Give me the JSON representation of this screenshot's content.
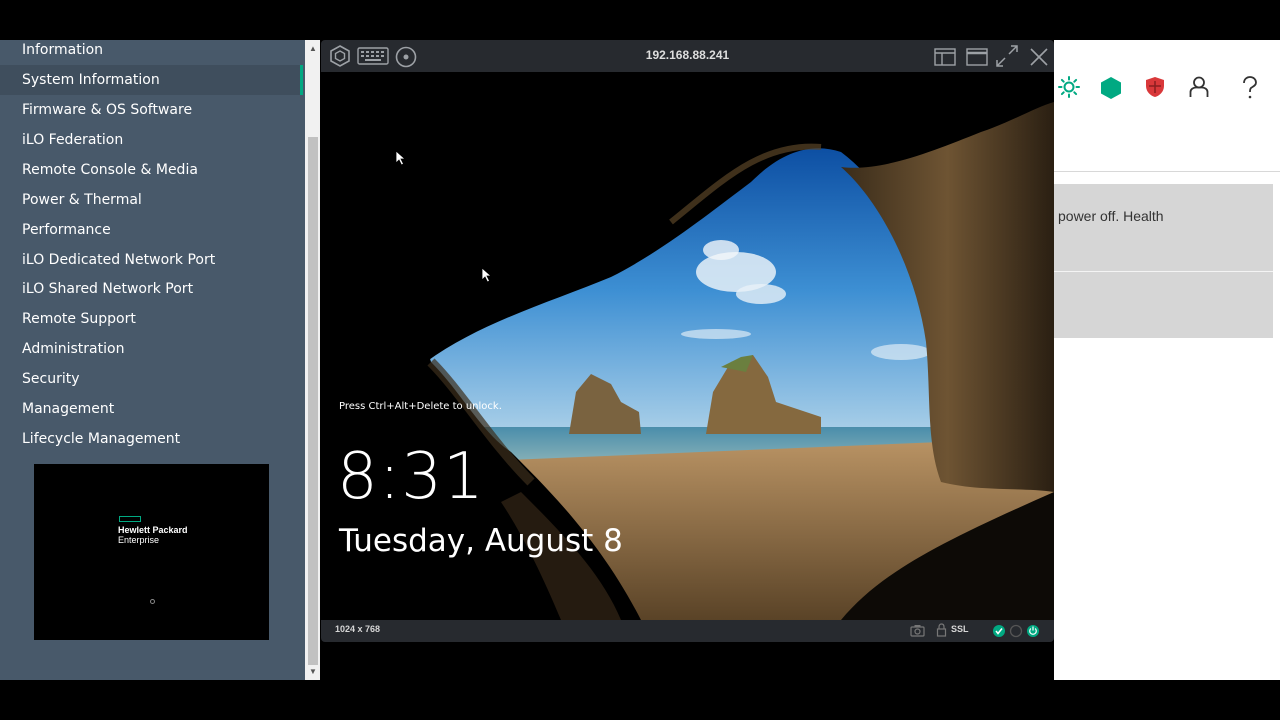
{
  "sidebar": {
    "items": [
      {
        "label": "Information"
      },
      {
        "label": "System Information"
      },
      {
        "label": "Firmware & OS Software"
      },
      {
        "label": "iLO Federation"
      },
      {
        "label": "Remote Console & Media"
      },
      {
        "label": "Power & Thermal"
      },
      {
        "label": "Performance"
      },
      {
        "label": "iLO Dedicated Network Port"
      },
      {
        "label": "iLO Shared Network Port"
      },
      {
        "label": "Remote Support"
      },
      {
        "label": "Administration"
      },
      {
        "label": "Security"
      },
      {
        "label": "Management"
      },
      {
        "label": "Lifecycle Management"
      }
    ],
    "active_index": 1,
    "thumbnail": {
      "brand_line1": "Hewlett Packard",
      "brand_line2": "Enterprise"
    }
  },
  "header": {
    "icons": [
      "sun-icon",
      "hexagon-status-icon",
      "shield-icon",
      "user-icon",
      "help-icon"
    ]
  },
  "main": {
    "info_text": "power off. Health"
  },
  "console": {
    "title": "192.168.88.241",
    "toolbar_icons": [
      "hpe-logo-icon",
      "keyboard-icon",
      "disc-icon"
    ],
    "window_icons": [
      "layout-icon",
      "restore-icon",
      "fullscreen-icon",
      "close-icon"
    ],
    "screen": {
      "unlock_text": "Press Ctrl+Alt+Delete to unlock.",
      "time": "8:31",
      "date": "Tuesday, August 8"
    },
    "status": {
      "resolution": "1024 x 768",
      "ssl_label": "SSL"
    }
  },
  "colors": {
    "sidebar_bg": "#48596a",
    "accent": "#01a982",
    "console_bar": "#272a2f"
  }
}
